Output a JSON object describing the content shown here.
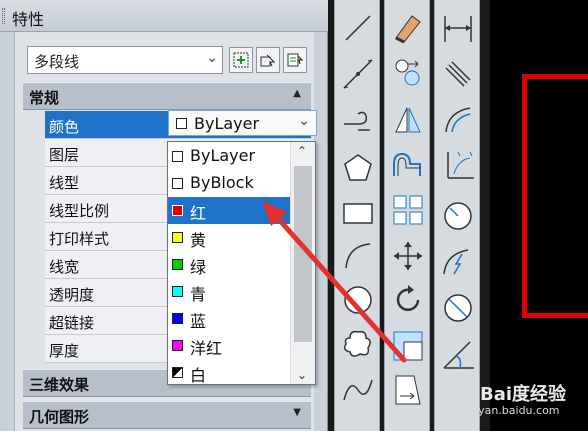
{
  "panel": {
    "title": "特性",
    "object_type": "多段线",
    "sections": {
      "general": "常规",
      "3d": "三维效果",
      "geometry": "几何图形"
    },
    "properties": [
      {
        "label": "颜色"
      },
      {
        "label": "图层"
      },
      {
        "label": "线型"
      },
      {
        "label": "线型比例"
      },
      {
        "label": "打印样式"
      },
      {
        "label": "线宽"
      },
      {
        "label": "透明度"
      },
      {
        "label": "超链接"
      },
      {
        "label": "厚度"
      }
    ],
    "color_value": "ByLayer"
  },
  "dropdown": {
    "items": [
      {
        "label": "ByLayer",
        "swatch": "#ffffff"
      },
      {
        "label": "ByBlock",
        "swatch": "#ffffff"
      },
      {
        "label": "红",
        "swatch": "#e00000"
      },
      {
        "label": "黄",
        "swatch": "#ffff00"
      },
      {
        "label": "绿",
        "swatch": "#00d000"
      },
      {
        "label": "青",
        "swatch": "#00ffff"
      },
      {
        "label": "蓝",
        "swatch": "#0000ff"
      },
      {
        "label": "洋红",
        "swatch": "#ff00ff"
      },
      {
        "label": "白",
        "swatch": "#000000"
      }
    ],
    "highlighted": "红"
  },
  "icons": {
    "tool_buttons": [
      "quick-select-icon",
      "select-objects-icon",
      "toggle-pickadd-icon"
    ],
    "toolbar_1": [
      "line-icon",
      "construction-line-icon",
      "polyline-icon",
      "polygon-icon",
      "rectangle-icon",
      "arc-icon",
      "circle-icon",
      "revcloud-icon",
      "spline-icon"
    ],
    "toolbar_2": [
      "erase-icon",
      "copy-icon",
      "mirror-icon",
      "offset-icon",
      "array-icon",
      "move-icon",
      "rotate-icon",
      "scale-icon",
      "stretch-icon"
    ],
    "toolbar_3": [
      "linear-dimension-icon",
      "aligned-dimension-icon",
      "arc-length-icon",
      "ordinate-dimension-icon",
      "radius-dimension-icon",
      "jogged-dimension-icon",
      "diameter-dimension-icon",
      "angular-dimension-icon"
    ]
  },
  "colors": {
    "accent": "#1e73c8",
    "annotation_arrow": "#e53030",
    "drawing_rect": "#e00000"
  },
  "watermark": {
    "main": "Bai度经验",
    "sub": "jingyan.baidu.com"
  }
}
